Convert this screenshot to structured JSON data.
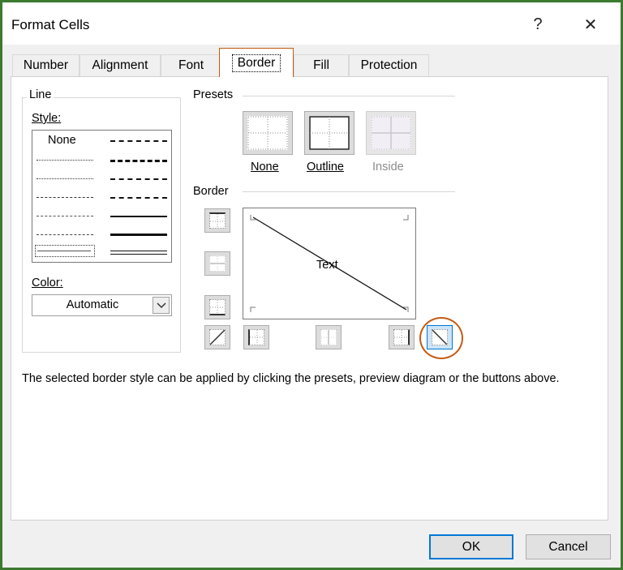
{
  "window": {
    "title": "Format Cells",
    "help_label": "?",
    "close_label": "✕"
  },
  "tabs": [
    {
      "label": "Number",
      "active": false
    },
    {
      "label": "Alignment",
      "active": false
    },
    {
      "label": "Font",
      "active": false
    },
    {
      "label": "Border",
      "active": true
    },
    {
      "label": "Fill",
      "active": false
    },
    {
      "label": "Protection",
      "active": false
    }
  ],
  "line": {
    "group_label": "Line",
    "style_label": "Style:",
    "style_none": "None",
    "color_label": "Color:",
    "color_value": "Automatic"
  },
  "presets": {
    "group_label": "Presets",
    "items": [
      {
        "label": "None",
        "enabled": true
      },
      {
        "label": "Outline",
        "enabled": true
      },
      {
        "label": "Inside",
        "enabled": false
      }
    ]
  },
  "border": {
    "group_label": "Border",
    "preview_text": "Text",
    "selected_button": "diagonal-down"
  },
  "description": "The selected border style can be applied by clicking the presets, preview diagram or the buttons above.",
  "footer": {
    "ok_label": "OK",
    "cancel_label": "Cancel"
  },
  "colors": {
    "highlight": "#c55a11",
    "frame": "#3b7a2f",
    "focus": "#0078d7"
  }
}
